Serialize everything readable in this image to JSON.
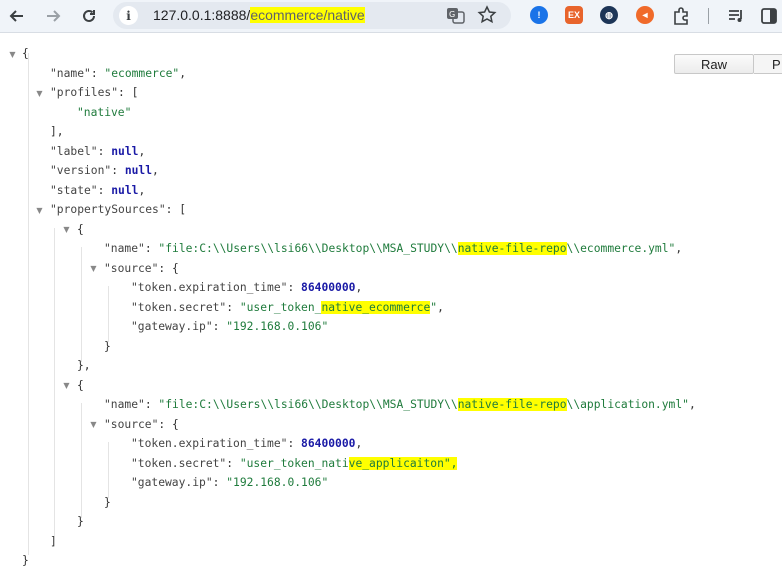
{
  "browser": {
    "url_host": "127.0.0.1:8888/",
    "url_path": "ecommerce/native"
  },
  "viewer": {
    "raw_label": "Raw",
    "pretty_label": "P"
  },
  "json_lines": [
    "{",
    "\"name\": \"ecommerce\",",
    "\"profiles\": [",
    "\"native\"",
    "],",
    "\"label\": null,",
    "\"version\": null,",
    "\"state\": null,",
    "\"propertySources\": [",
    "{",
    "\"name\": \"file:C:\\\\Users\\\\lsi66\\\\Desktop\\\\MSA_STUDY\\\\native-file-repo\\\\ecommerce.yml\",",
    "\"source\": {",
    "\"token.expiration_time\": 86400000,",
    "\"token.secret\": \"user_token_native_ecommerce\",",
    "\"gateway.ip\": \"192.168.0.106\"",
    "}",
    "},",
    "{",
    "\"name\": \"file:C:\\\\Users\\\\lsi66\\\\Desktop\\\\MSA_STUDY\\\\native-file-repo\\\\application.yml\",",
    "\"source\": {",
    "\"token.expiration_time\": 86400000,",
    "\"token.secret\": \"user_token_native_applicaiton\",",
    "\"gateway.ip\": \"192.168.0.106\"",
    "}",
    "}",
    "]",
    "}"
  ],
  "json_tokens": {
    "root_open": "{",
    "name_key": "\"name\"",
    "name_val": "\"ecommerce\"",
    "profiles_key": "\"profiles\"",
    "profile_0": "\"native\"",
    "label_key": "\"label\"",
    "version_key": "\"version\"",
    "state_key": "\"state\"",
    "null": "null",
    "ps_key": "\"propertySources\"",
    "src_key": "\"source\"",
    "exp_key": "\"token.expiration_time\"",
    "exp_val": "86400000",
    "secret_key": "\"token.secret\"",
    "gw_key": "\"gateway.ip\"",
    "gw_val": "\"192.168.0.106\"",
    "ps0_name_a": "\"file:C:\\\\Users\\\\lsi66\\\\Desktop\\\\MSA_STUDY\\\\",
    "ps0_name_b": "native-file-repo",
    "ps0_name_c": "\\\\ecommerce.yml\"",
    "ps0_secret_a": "\"user_token_",
    "ps0_secret_b": "native_ecommerce",
    "ps0_secret_c": "\"",
    "ps1_name_a": "\"file:C:\\\\Users\\\\lsi66\\\\Desktop\\\\MSA_STUDY\\\\",
    "ps1_name_b": "native-file-repo",
    "ps1_name_c": "\\\\application.yml\"",
    "ps1_secret_a": "\"user_token_nati",
    "ps1_secret_b": "ve_applicaiton\",",
    "ps1_secret_c": ""
  }
}
